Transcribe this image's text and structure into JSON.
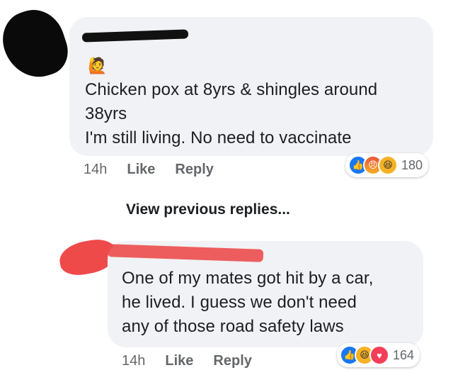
{
  "comments": [
    {
      "emoji": "🙋",
      "lines": [
        "Chicken pox at 8yrs & shingles around",
        "38yrs",
        "I'm still living. No need to vaccinate"
      ],
      "time": "14h",
      "like_label": "Like",
      "reply_label": "Reply",
      "reactions": [
        "like",
        "angry",
        "haha"
      ],
      "reaction_count": "180"
    },
    {
      "lines": [
        "One of my mates got hit by a car,",
        "he lived. I guess we don't need",
        "any of those road safety laws"
      ],
      "time": "14h",
      "like_label": "Like",
      "reply_label": "Reply",
      "reactions": [
        "like",
        "haha",
        "love"
      ],
      "reaction_count": "164"
    }
  ],
  "view_previous": "View previous replies...",
  "colors": {
    "bubble": "#f0f2f5",
    "like_blue": "#1877f2",
    "love_red": "#f33e58",
    "haha_yellow": "#f7b125",
    "meta_gray": "#65676b",
    "redaction_black": "#0a0a0a",
    "redaction_red": "#ef4a4a"
  }
}
